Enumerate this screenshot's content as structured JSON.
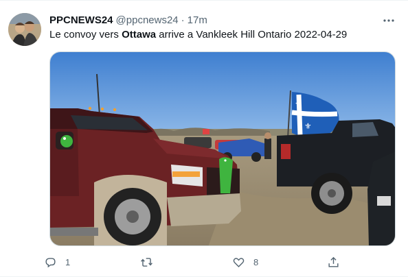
{
  "tweet": {
    "display_name": "PPCNEWS24",
    "handle": "@ppcnews24",
    "separator": "·",
    "time": "17m",
    "text_before": "Le convoy vers ",
    "text_bold": "Ottawa",
    "text_after": " arrive a Vankleek Hill Ontario 2022-04-29"
  },
  "actions": {
    "reply_count": "1",
    "retweet_count": "",
    "like_count": "8"
  },
  "icons": {
    "more": "more-icon",
    "reply": "reply-icon",
    "retweet": "retweet-icon",
    "like": "like-icon",
    "share": "share-icon"
  },
  "colors": {
    "text": "#0f1419",
    "muted": "#536471",
    "border": "#cfd9de",
    "flag_blue": "#1f5fb8"
  }
}
